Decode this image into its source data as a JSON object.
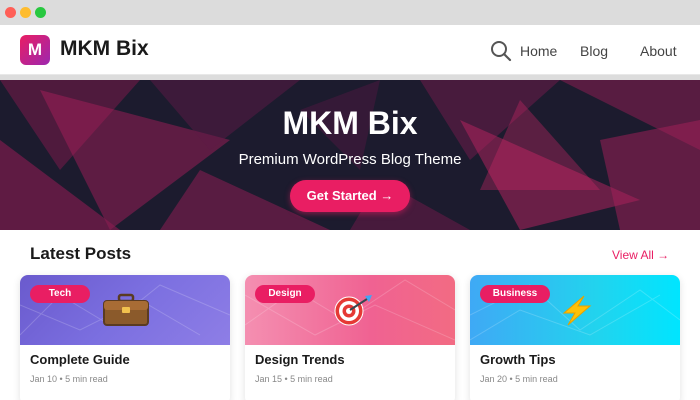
{
  "header": {
    "logo_letter": "M",
    "brand": "MKM Bix",
    "nav": [
      {
        "label": "Home"
      },
      {
        "label": "Blog"
      },
      {
        "label": "About"
      }
    ]
  },
  "hero": {
    "title": "MKM Bix",
    "subtitle": "Premium WordPress Blog Theme",
    "cta_label": "Get Started →"
  },
  "latest": {
    "title": "Latest Posts",
    "view_all": "View All →",
    "posts": [
      {
        "category": "Tech",
        "title": "Complete Guide",
        "meta": "Jan 10 • 5 min read",
        "icon": "briefcase-icon"
      },
      {
        "category": "Design",
        "title": "Design Trends",
        "meta": "Jan 15 • 5 min read",
        "icon": "target-icon"
      },
      {
        "category": "Business",
        "title": "Growth Tips",
        "meta": "Jan 20 • 5 min read",
        "icon": "lightning-icon"
      }
    ]
  },
  "colors": {
    "accent": "#e91e63",
    "hero_bg": "#1a1a2e"
  }
}
